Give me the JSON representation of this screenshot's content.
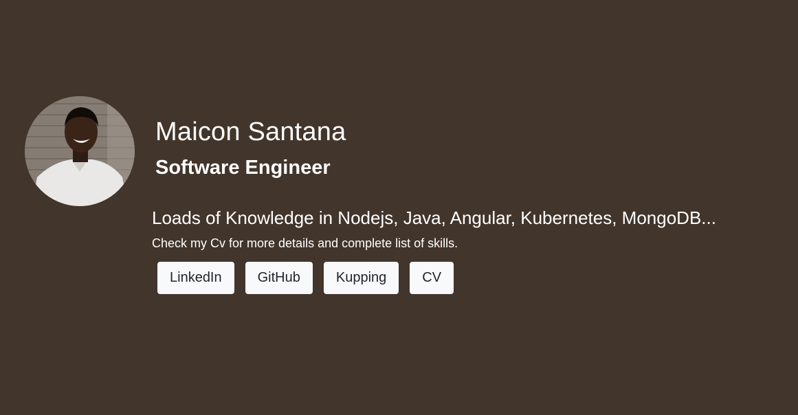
{
  "profile": {
    "name": "Maicon Santana",
    "role": "Software Engineer",
    "knowledge": "Loads of Knowledge in Nodejs, Java, Angular, Kubernetes, MongoDB...",
    "note": "Check my Cv for more details and complete list of skills."
  },
  "links": [
    {
      "label": "LinkedIn"
    },
    {
      "label": "GitHub"
    },
    {
      "label": "Kupping"
    },
    {
      "label": "CV"
    }
  ],
  "colors": {
    "background": "#42352c",
    "text": "#ffffff",
    "button_bg": "#f8f9fa",
    "button_text": "#212529"
  }
}
